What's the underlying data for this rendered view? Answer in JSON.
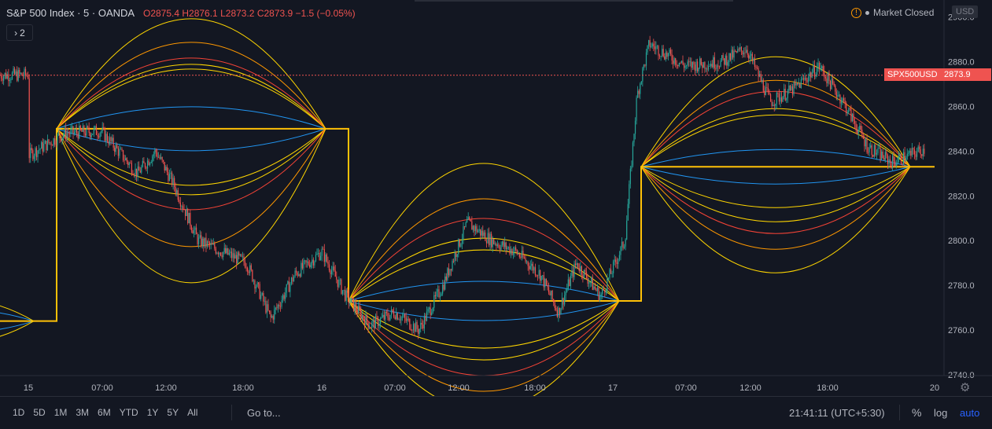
{
  "legend": {
    "symbol": "S&P 500 Index · 5 · OANDA",
    "open_label": "O",
    "open": "2875.4",
    "high_label": "H",
    "high": "2876.1",
    "low_label": "L",
    "low": "2873.2",
    "close_label": "C",
    "close": "2873.9",
    "change": "−1.5 (−0.05%)",
    "toggle_count": "2"
  },
  "market_status": "Market Closed",
  "currency": "USD",
  "price_tag": {
    "symbol": "SPX500USD",
    "price": "2873.9"
  },
  "price_axis": {
    "ticks": [
      "2900.0",
      "2880.0",
      "2860.0",
      "2840.0",
      "2820.0",
      "2800.0",
      "2780.0",
      "2760.0",
      "2740.0"
    ]
  },
  "time_axis": {
    "ticks": [
      "15",
      "07:00",
      "12:00",
      "18:00",
      "16",
      "07:00",
      "12:00",
      "18:00",
      "17",
      "07:00",
      "12:00",
      "18:00",
      "20"
    ]
  },
  "bottom_bar": {
    "ranges": [
      "1D",
      "5D",
      "1M",
      "3M",
      "6M",
      "YTD",
      "1Y",
      "5Y",
      "All"
    ],
    "goto": "Go to...",
    "clock": "21:41:11 (UTC+5:30)",
    "percent": "%",
    "log": "log",
    "auto": "auto"
  },
  "colors": {
    "background": "#131722",
    "up": "#26a69a",
    "down": "#ef5350",
    "step_line": "#ffc107",
    "arc_blue": "#2196f3",
    "arc_yellow": "#ffd600",
    "arc_orange": "#ff9800",
    "arc_red": "#f44336",
    "last_price": "#ef5350"
  },
  "chart_data": {
    "type": "candlestick",
    "symbol": "SPX500USD",
    "ylim": [
      2740,
      2900
    ],
    "last_price": 2873.9,
    "step_levels": [
      {
        "segment": "15",
        "value": 2764
      },
      {
        "segment": "15 07:00-16 00:00",
        "value": 2850
      },
      {
        "segment": "16 00:00-17 00:00",
        "value": 2773
      },
      {
        "segment": "17 00:00-20 00:00",
        "value": 2833
      }
    ],
    "close_path": [
      {
        "t": "15 00:00",
        "v": 2838
      },
      {
        "t": "15 03:00",
        "v": 2848
      },
      {
        "t": "15 06:00",
        "v": 2849
      },
      {
        "t": "15 09:00",
        "v": 2830
      },
      {
        "t": "15 10:30",
        "v": 2840
      },
      {
        "t": "15 12:00",
        "v": 2825
      },
      {
        "t": "15 14:00",
        "v": 2800
      },
      {
        "t": "15 16:00",
        "v": 2795
      },
      {
        "t": "15 18:00",
        "v": 2790
      },
      {
        "t": "15 20:00",
        "v": 2765
      },
      {
        "t": "15 22:00",
        "v": 2785
      },
      {
        "t": "16 00:00",
        "v": 2795
      },
      {
        "t": "16 02:00",
        "v": 2775
      },
      {
        "t": "16 04:00",
        "v": 2762
      },
      {
        "t": "16 06:00",
        "v": 2768
      },
      {
        "t": "16 08:00",
        "v": 2760
      },
      {
        "t": "16 10:00",
        "v": 2780
      },
      {
        "t": "16 12:00",
        "v": 2808
      },
      {
        "t": "16 14:00",
        "v": 2800
      },
      {
        "t": "16 16:00",
        "v": 2795
      },
      {
        "t": "16 18:00",
        "v": 2785
      },
      {
        "t": "16 19:30",
        "v": 2768
      },
      {
        "t": "16 21:00",
        "v": 2790
      },
      {
        "t": "16 23:00",
        "v": 2775
      },
      {
        "t": "17 01:00",
        "v": 2800
      },
      {
        "t": "17 02:00",
        "v": 2865
      },
      {
        "t": "17 03:00",
        "v": 2888
      },
      {
        "t": "17 06:00",
        "v": 2878
      },
      {
        "t": "17 09:00",
        "v": 2880
      },
      {
        "t": "17 11:00",
        "v": 2886
      },
      {
        "t": "17 13:00",
        "v": 2862
      },
      {
        "t": "17 15:00",
        "v": 2868
      },
      {
        "t": "17 17:00",
        "v": 2878
      },
      {
        "t": "17 19:00",
        "v": 2862
      },
      {
        "t": "17 21:00",
        "v": 2842
      },
      {
        "t": "17 23:00",
        "v": 2835
      },
      {
        "t": "18 01:00",
        "v": 2845
      },
      {
        "t": "18 03:00",
        "v": 2834
      },
      {
        "t": "18 05:00",
        "v": 2874
      }
    ]
  }
}
